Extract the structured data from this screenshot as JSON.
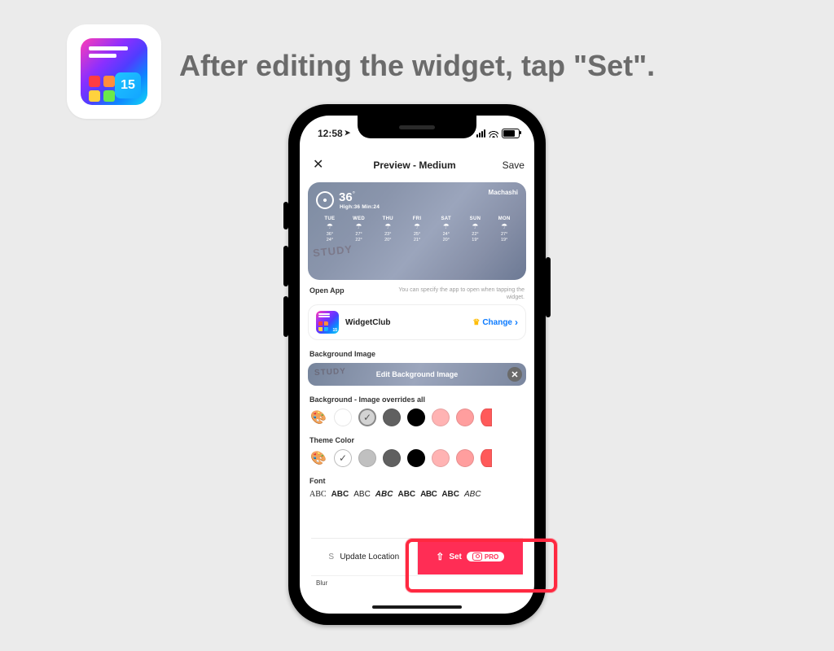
{
  "app_icon_number": "15",
  "instruction_text": "After editing the widget, tap \"Set\".",
  "status": {
    "time": "12:58",
    "loc_glyph": "➤"
  },
  "nav": {
    "close_glyph": "✕",
    "title": "Preview - Medium",
    "save": "Save"
  },
  "preview": {
    "location": "Machashi",
    "temp": "36",
    "deg": "°",
    "hi_lo": "High:36  Min:24",
    "bg_overlay": "STUDY",
    "days": [
      {
        "d": "TUE",
        "hi": "36",
        "lo": "24"
      },
      {
        "d": "WED",
        "hi": "27",
        "lo": "22"
      },
      {
        "d": "THU",
        "hi": "23",
        "lo": "20"
      },
      {
        "d": "FRI",
        "hi": "25",
        "lo": "21"
      },
      {
        "d": "SAT",
        "hi": "24",
        "lo": "20"
      },
      {
        "d": "SUN",
        "hi": "22",
        "lo": "19"
      },
      {
        "d": "MON",
        "hi": "27",
        "lo": "19"
      }
    ]
  },
  "open_app": {
    "label": "Open App",
    "hint": "You can specify the app to open when tapping the widget.",
    "app_name": "WidgetClub",
    "change": "Change",
    "mini_num": "15"
  },
  "bg_image": {
    "title": "Background Image",
    "button_label": "Edit Background Image",
    "overlay": "STUDY",
    "x": "✕"
  },
  "bg_color": {
    "title": "Background - Image overrides all",
    "swatches": [
      "#ffffff",
      "#d3d3d3",
      "#606060",
      "#000000",
      "#ffb3b3",
      "#ff9e9e",
      "#ff5a5a"
    ]
  },
  "theme_color": {
    "title": "Theme Color",
    "swatches": [
      "#ffffff",
      "#c0c0c0",
      "#606060",
      "#000000",
      "#ffb3b3",
      "#ff9e9e",
      "#ff5a5a"
    ]
  },
  "font": {
    "title": "Font",
    "samples": [
      "ABC",
      "ABC",
      "ABC",
      "ABC",
      "ABC",
      "ABC",
      "ABC",
      "ABC"
    ]
  },
  "tabs": {
    "update_location": "Update Location",
    "set": "Set",
    "pro": "PRO",
    "upload_glyph": "⇧"
  },
  "blur_label": "Blur",
  "s_letter": "S"
}
